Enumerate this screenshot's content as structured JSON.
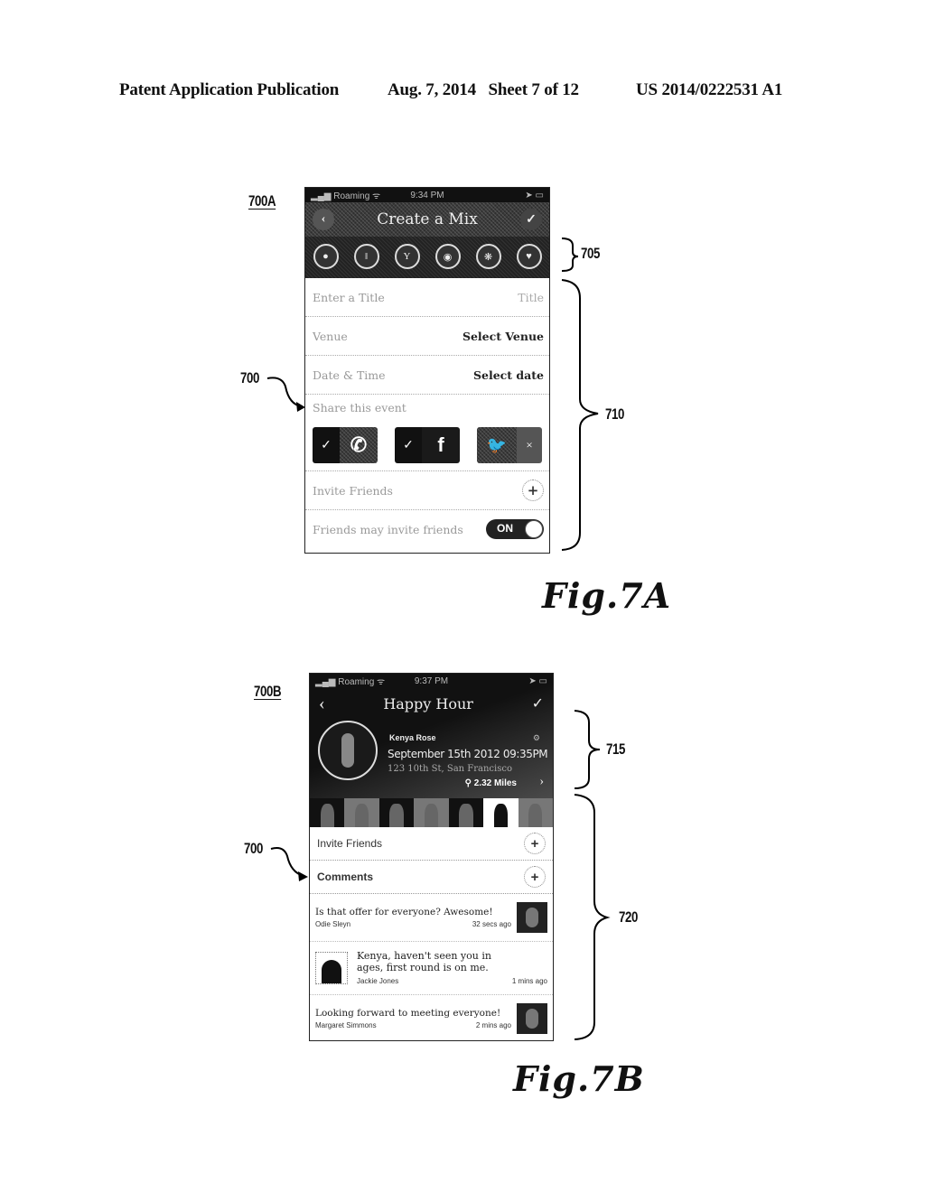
{
  "header": {
    "publication": "Patent Application Publication",
    "date_sheet": "Aug. 7, 2014   Sheet 7 of 12",
    "patent_number": "US 2014/0222531 A1"
  },
  "figures": {
    "fig7a": {
      "caption": "Fig.7A",
      "ref_screen": "700A",
      "ref_element": "700",
      "ref_categories": "705",
      "ref_form": "710",
      "screen": {
        "status": {
          "carrier": "Roaming",
          "time": "9:34 PM"
        },
        "title": "Create a Mix",
        "back_icon": "chevron-left-icon",
        "confirm_icon": "checkmark-icon",
        "categories": [
          {
            "icon": "round-icon",
            "glyph": "●"
          },
          {
            "icon": "fork-knife-icon",
            "glyph": "‖"
          },
          {
            "icon": "cocktail-icon",
            "glyph": "Y"
          },
          {
            "icon": "ball-icon",
            "glyph": "◉"
          },
          {
            "icon": "pattern-icon",
            "glyph": "❋"
          },
          {
            "icon": "heart-icon",
            "glyph": "♥"
          }
        ],
        "fields": [
          {
            "label": "Enter a Title",
            "value": "Title",
            "placeholder": true
          },
          {
            "label": "Venue",
            "value": "Select Venue",
            "placeholder": false
          },
          {
            "label": "Date & Time",
            "value": "Select date",
            "placeholder": false
          }
        ],
        "share_label": "Share this event",
        "share_buttons": [
          {
            "service": "custom",
            "glyph": "✆",
            "checked": true,
            "check": "✓"
          },
          {
            "service": "facebook",
            "glyph": "f",
            "checked": true,
            "check": "✓"
          },
          {
            "service": "twitter",
            "glyph": "🐦",
            "checked": false,
            "x": "×"
          }
        ],
        "invite_label": "Invite Friends",
        "plus": "+",
        "friends_invite_label": "Friends may invite friends",
        "toggle_label": "ON"
      }
    },
    "fig7b": {
      "caption": "Fig.7B",
      "ref_screen": "700B",
      "ref_element": "700",
      "ref_header": "715",
      "ref_body": "720",
      "screen": {
        "status": {
          "carrier": "Roaming",
          "time": "9:37 PM"
        },
        "title": "Happy Hour",
        "back": "‹",
        "confirm": "✓",
        "host": "Kenya Rose",
        "datetime": "September 15th 2012 09:35PM",
        "address": "123 10th St, San Francisco",
        "distance": "2.32 Miles",
        "pin": "⚲",
        "chevron": "›",
        "settings": "⚙",
        "invite_label": "Invite Friends",
        "comments_label": "Comments",
        "plus": "+",
        "comments": [
          {
            "text": "Is that offer for everyone? Awesome!",
            "author": "Odie Sleyn",
            "time": "32 secs ago",
            "thumb_side": "right"
          },
          {
            "text": "Kenya, haven't seen you in ages, first round is on me.",
            "author": "Jackie Jones",
            "time": "1 mins ago",
            "thumb_side": "left"
          },
          {
            "text": "Looking forward to meeting everyone!",
            "author": "Margaret Simmons",
            "time": "2 mins ago",
            "thumb_side": "right"
          }
        ]
      }
    }
  }
}
